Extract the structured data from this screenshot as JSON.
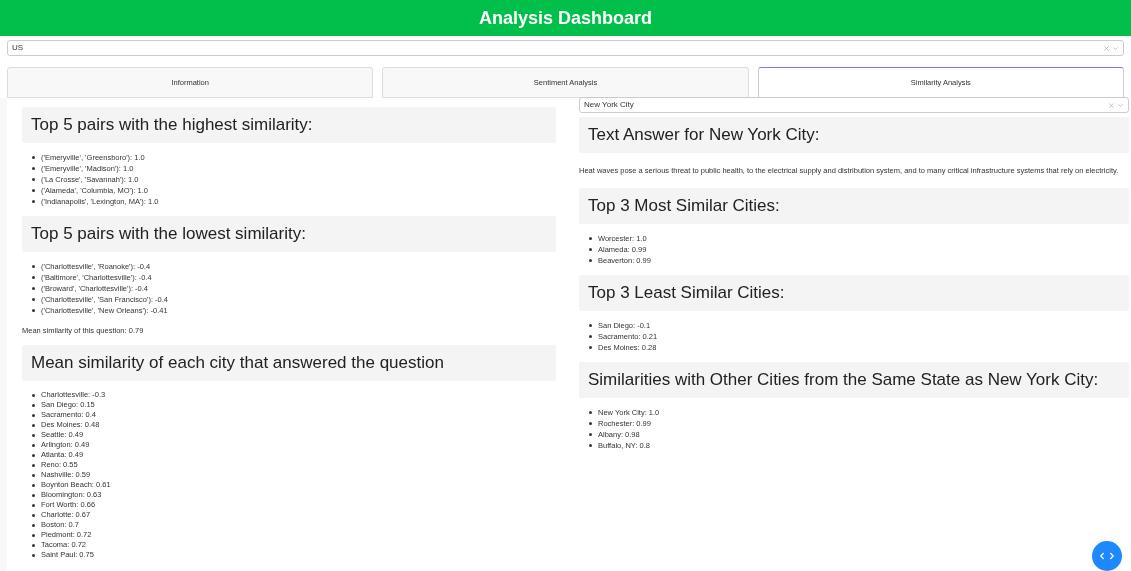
{
  "header": {
    "title": "Analysis Dashboard"
  },
  "country_select": {
    "value": "US"
  },
  "tabs": [
    {
      "label": "Information",
      "selected": false
    },
    {
      "label": "Sentiment Analysis",
      "selected": false
    },
    {
      "label": "Similarity Analysis",
      "selected": true
    }
  ],
  "left": {
    "sections": [
      {
        "heading": "Top 5 pairs with the highest similarity:",
        "items": [
          "('Emeryville', 'Greensboro'): 1.0",
          "('Emeryville', 'Madison'): 1.0",
          "('La Crosse', 'Savannah'): 1.0",
          "('Alameda', 'Columbia, MO'): 1.0",
          "('Indianapolis', 'Lexington, MA'): 1.0"
        ]
      },
      {
        "heading": "Top 5 pairs with the lowest similarity:",
        "items": [
          "('Charlottesville', 'Roanoke'): -0.4",
          "('Baltimore', 'Charlottesville'): -0.4",
          "('Broward', 'Charlottesville'): -0.4",
          "('Charlottesville', 'San Francisco'): -0.4",
          "('Charlottesville', 'New Orleans'): -0.41"
        ],
        "note": "Mean similarity of this question: 0.79"
      },
      {
        "heading": "Mean similarity of each city that answered the question",
        "items": [
          "Charlottesville: -0.3",
          "San Diego: 0.15",
          "Sacramento: 0.4",
          "Des Moines: 0.48",
          "Seattle: 0.49",
          "Arlington: 0.49",
          "Atlanta: 0.49",
          "Reno: 0.55",
          "Nashville: 0.59",
          "Boynton Beach: 0.61",
          "Bloomington: 0.63",
          "Fort Worth: 0.66",
          "Charlotte: 0.67",
          "Boston: 0.7",
          "Piedmont: 0.72",
          "Tacoma: 0.72",
          "Saint Paul: 0.75"
        ]
      }
    ]
  },
  "right": {
    "city_select": {
      "value": "New York City"
    },
    "answer_heading": "Text Answer for New York City:",
    "answer_text": "Heat waves pose a serious threat to public health, to the electrical supply and distribution system, and to many critical infrastructure systems that rely on electricity.",
    "sections": [
      {
        "heading": "Top 3 Most Similar Cities:",
        "items": [
          "Worcester: 1.0",
          "Alameda: 0.99",
          "Beaverton: 0.99"
        ]
      },
      {
        "heading": "Top 3 Least Similar Cities:",
        "items": [
          "San Diego: -0.1",
          "Sacramento: 0.21",
          "Des Moines: 0.28"
        ]
      },
      {
        "heading": "Similarities with Other Cities from the Same State as New York City:",
        "items": [
          "New York City: 1.0",
          "Rochester: 0.99",
          "Albany: 0.98",
          "Buffalo, NY: 0.8"
        ]
      }
    ]
  }
}
